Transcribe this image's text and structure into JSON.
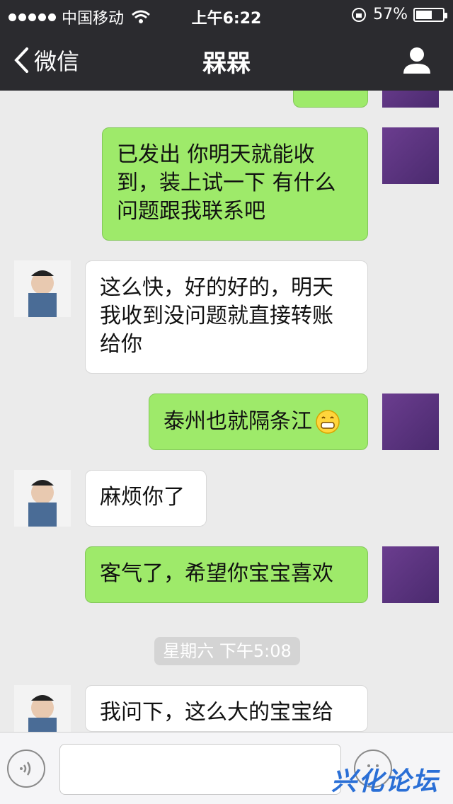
{
  "status_bar": {
    "carrier": "中国移动",
    "time": "上午6:22",
    "battery": "57%",
    "battery_level": 0.57
  },
  "nav": {
    "back_label": "微信",
    "title": "槑槑"
  },
  "messages": [
    {
      "from": "me",
      "text": "已发出 你明天就能收到，装上试一下 有什么问题跟我联系吧"
    },
    {
      "from": "them",
      "text": "这么快，好的好的，明天我收到没问题就直接转账给你"
    },
    {
      "from": "me",
      "text": "泰州也就隔条江"
    },
    {
      "from": "them",
      "text": "麻烦你了"
    },
    {
      "from": "me",
      "text": "客气了，希望你宝宝喜欢"
    },
    {
      "from": "them",
      "text": "我问下，这么大的宝宝给"
    }
  ],
  "timestamp": "星期六 下午5:08",
  "watermark": "兴化论坛",
  "colors": {
    "my_bubble": "#9eea6a",
    "their_bubble": "#ffffff",
    "nav_bg": "#2b2b2f",
    "chat_bg": "#ebebeb"
  },
  "icons": [
    "back-chevron-icon",
    "person-icon",
    "wifi-icon",
    "lock-rotation-icon",
    "battery-icon",
    "voice-icon",
    "emoji-icon",
    "grin-emoji-icon"
  ]
}
